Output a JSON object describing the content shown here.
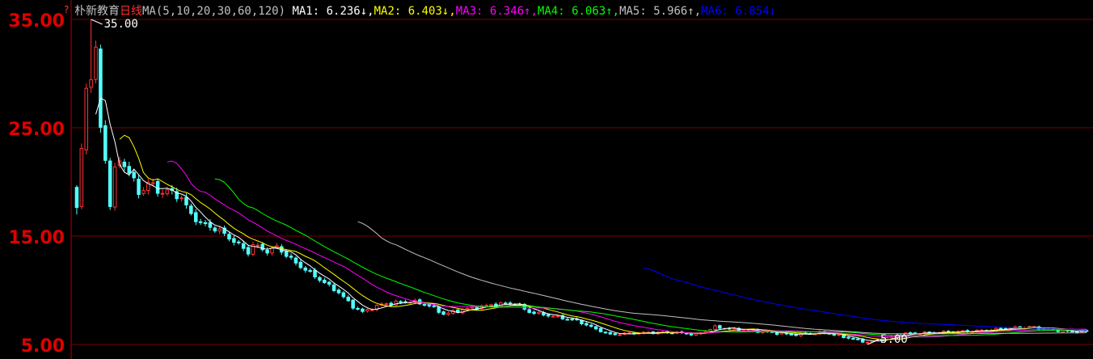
{
  "header": {
    "stock_name": "朴新教育",
    "period": "日线",
    "ma_spec": "MA(5,10,20,30,60,120)",
    "separator": ",",
    "ma_values": [
      {
        "label": "MA1: ",
        "value": "6.236",
        "arrow": "↓",
        "color": "#FFFFFF"
      },
      {
        "label": "MA2: ",
        "value": "6.403",
        "arrow": "↓",
        "color": "#FFFF00"
      },
      {
        "label": "MA3: ",
        "value": "6.346",
        "arrow": "↑",
        "color": "#FF00FF"
      },
      {
        "label": "MA4: ",
        "value": "6.063",
        "arrow": "↑",
        "color": "#00FF00"
      },
      {
        "label": "MA5: ",
        "value": "5.966",
        "arrow": "↑",
        "color": "#C0C0C0"
      },
      {
        "label": "MA6: ",
        "value": "6.854",
        "arrow": "↓",
        "color": "#0000FF"
      }
    ]
  },
  "chart_data": {
    "type": "candlestick",
    "ylim": [
      5.0,
      35.0
    ],
    "y_ticks": [
      "35.00",
      "25.00",
      "15.00",
      "5.00"
    ],
    "annotations": [
      {
        "text": "35.00",
        "kind": "high"
      },
      {
        "text": "5.00",
        "kind": "low"
      }
    ],
    "colors": {
      "up": "#FF3232",
      "down": "#54FFFF",
      "grid": "#7A0000",
      "axis": "#B00000",
      "label": "#E00000"
    },
    "num_bars": 213,
    "anchors": [
      [
        0,
        17.5
      ],
      [
        1,
        23.0
      ],
      [
        2,
        28.5
      ],
      [
        3,
        30.0
      ],
      [
        4,
        32.0
      ],
      [
        5,
        25.0
      ],
      [
        6,
        22.0
      ],
      [
        7,
        18.0
      ],
      [
        8,
        21.0
      ],
      [
        9,
        22.0
      ],
      [
        10,
        21.5
      ],
      [
        11,
        21.0
      ],
      [
        12,
        20.0
      ],
      [
        13,
        19.0
      ],
      [
        14,
        19.3
      ],
      [
        15,
        20.0
      ],
      [
        16,
        19.6
      ],
      [
        17,
        19.2
      ],
      [
        18,
        19.0
      ],
      [
        19,
        19.2
      ],
      [
        20,
        19.0
      ],
      [
        22,
        18.5
      ],
      [
        24,
        17.0
      ],
      [
        26,
        16.2
      ],
      [
        30,
        15.5
      ],
      [
        34,
        14.2
      ],
      [
        36,
        13.5
      ],
      [
        37,
        14.2
      ],
      [
        40,
        13.6
      ],
      [
        42,
        14.0
      ],
      [
        46,
        12.5
      ],
      [
        50,
        11.3
      ],
      [
        55,
        9.8
      ],
      [
        58,
        8.5
      ],
      [
        60,
        8.0
      ],
      [
        64,
        8.7
      ],
      [
        70,
        9.0
      ],
      [
        74,
        8.6
      ],
      [
        77,
        7.8
      ],
      [
        82,
        8.3
      ],
      [
        88,
        8.7
      ],
      [
        92,
        8.8
      ],
      [
        95,
        8.0
      ],
      [
        100,
        7.6
      ],
      [
        105,
        7.2
      ],
      [
        108,
        6.6
      ],
      [
        112,
        5.9
      ],
      [
        115,
        6.0
      ],
      [
        120,
        6.1
      ],
      [
        126,
        6.1
      ],
      [
        130,
        5.9
      ],
      [
        134,
        6.6
      ],
      [
        138,
        6.4
      ],
      [
        144,
        6.2
      ],
      [
        150,
        5.9
      ],
      [
        157,
        6.1
      ],
      [
        162,
        5.6
      ],
      [
        166,
        5.2
      ],
      [
        168,
        5.4
      ],
      [
        174,
        6.0
      ],
      [
        180,
        6.1
      ],
      [
        186,
        6.2
      ],
      [
        191,
        6.3
      ],
      [
        195,
        6.5
      ],
      [
        200,
        6.6
      ],
      [
        204,
        6.4
      ],
      [
        208,
        6.2
      ],
      [
        212,
        6.236
      ]
    ],
    "moving_averages": [
      {
        "label": "MA1",
        "period": 5,
        "color": "#FFFFFF"
      },
      {
        "label": "MA2",
        "period": 10,
        "color": "#FFFF00"
      },
      {
        "label": "MA3",
        "period": 20,
        "color": "#FF00FF"
      },
      {
        "label": "MA4",
        "period": 30,
        "color": "#00FF00"
      },
      {
        "label": "MA5",
        "period": 60,
        "color": "#C0C0C0"
      },
      {
        "label": "MA6",
        "period": 120,
        "color": "#0000FF"
      }
    ]
  }
}
